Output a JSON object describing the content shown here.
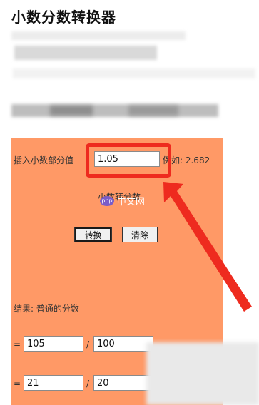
{
  "page": {
    "title": "小数分数转换器"
  },
  "converter": {
    "input_label": "插入小数部分值",
    "input_value": "1.05",
    "example_text": "例如: 2.682",
    "subtitle": "小数转分数",
    "convert_label": "转换",
    "clear_label": "清除",
    "result_label": "结果: 普通的分数",
    "equals": "=",
    "slash": "/",
    "result_normal": {
      "numerator": "105",
      "denominator": "100"
    },
    "result_simplified": {
      "numerator": "21",
      "denominator": "20"
    }
  },
  "watermark": {
    "logo": "php",
    "text": "中文网"
  },
  "annotation": {
    "highlight_color": "#ee2b1f"
  },
  "colors": {
    "panel_bg": "#ff9966"
  }
}
